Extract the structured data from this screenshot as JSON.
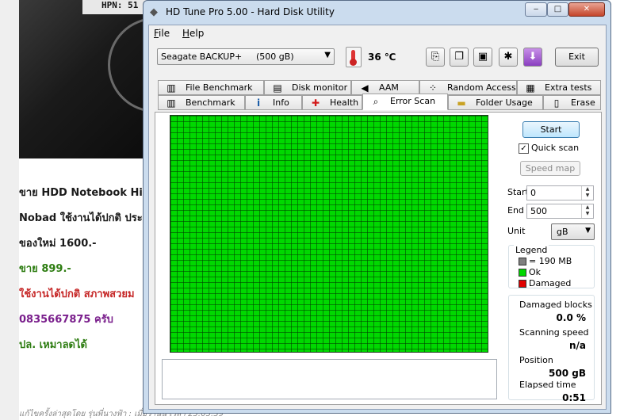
{
  "background_page": {
    "photo_label": "HPN: 51",
    "lines": [
      {
        "text": "ขาย HDD Notebook Hi",
        "color": "#1a1a1a"
      },
      {
        "text": "Nobad ใช้งานได้ปกติ ประ",
        "color": "#1a1a1a"
      },
      {
        "text": "ของใหม่ 1600.-",
        "color": "#1a1a1a"
      },
      {
        "text": "ขาย 899.-",
        "color": "#2e7d12"
      },
      {
        "text": "ใช้งานได้ปกติ สภาพสวยม",
        "color": "#c62828"
      },
      {
        "text": "0835667875 ครับ",
        "color": "#7a1f8c"
      },
      {
        "text": "ปล. เหมาลดได้",
        "color": "#2e7d12"
      }
    ],
    "footer": "แก้ไขครั้งล่าสุดโดย รุ่นพี่นางฟ้า : เมื่อวานนี้ เวลา 23:05:39"
  },
  "window": {
    "title": "HD Tune Pro 5.00 - Hard Disk Utility",
    "controls": {
      "minimize": "‒",
      "maximize": "□",
      "close": "✕"
    }
  },
  "menu": {
    "file": {
      "first": "F",
      "rest": "ile"
    },
    "help": {
      "first": "H",
      "rest": "elp"
    }
  },
  "toolbar": {
    "drive_name": "Seagate BACKUP+",
    "drive_capacity": "(500 gB)",
    "temperature": "36 ℃",
    "exit_label": "Exit",
    "icons": {
      "copy_text": "copy-text-icon",
      "copy_screen": "copy-screenshot-icon",
      "save": "save-icon",
      "options": "options-icon",
      "download": "download-icon"
    }
  },
  "tabs": {
    "row1": [
      {
        "label": "File Benchmark",
        "icon": "file-benchmark-icon"
      },
      {
        "label": "Disk monitor",
        "icon": "disk-monitor-icon"
      },
      {
        "label": "AAM",
        "icon": "speaker-icon"
      },
      {
        "label": "Random Access",
        "icon": "random-access-icon"
      },
      {
        "label": "Extra tests",
        "icon": "extra-tests-icon"
      }
    ],
    "row2": [
      {
        "label": "Benchmark",
        "icon": "benchmark-icon"
      },
      {
        "label": "Info",
        "icon": "info-icon"
      },
      {
        "label": "Health",
        "icon": "health-cross-icon"
      },
      {
        "label": "Error Scan",
        "icon": "magnifier-icon",
        "active": true
      },
      {
        "label": "Folder Usage",
        "icon": "folder-icon"
      },
      {
        "label": "Erase",
        "icon": "trash-icon"
      }
    ]
  },
  "error_scan": {
    "start_label": "Start",
    "quick_scan_label": "Quick scan",
    "quick_scan_checked": true,
    "speed_map_label": "Speed map",
    "start_field_label": "Start",
    "start_value": "0",
    "end_field_label": "End",
    "end_value": "500",
    "unit_label": "Unit",
    "unit_value": "gB",
    "legend": {
      "title": "Legend",
      "items": [
        {
          "label": "= 190 MB",
          "color": "#7f7f7f"
        },
        {
          "label": "Ok",
          "color": "#00d800"
        },
        {
          "label": "Damaged",
          "color": "#e00000"
        }
      ]
    },
    "stats": {
      "damaged_blocks_label": "Damaged blocks",
      "damaged_blocks_value": "0.0 %",
      "scanning_speed_label": "Scanning speed",
      "scanning_speed_value": "n/a",
      "position_label": "Position",
      "position_value": "500 gB",
      "elapsed_label": "Elapsed time",
      "elapsed_value": "0:51"
    },
    "grid_status": "all blocks ok",
    "colors": {
      "ok": "#00d800",
      "grid_line": "#003c00"
    }
  }
}
